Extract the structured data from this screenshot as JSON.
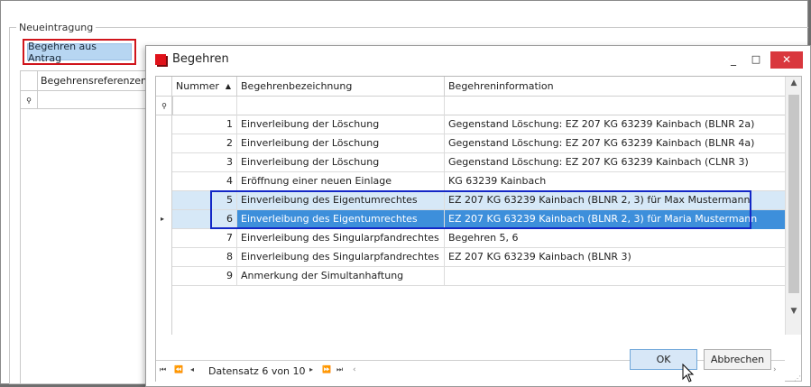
{
  "outer": {
    "group_title": "Neueintragung",
    "antrag_button": "Begehren aus Antrag",
    "left_grid_header": "Begehrensreferenzen",
    "filter_pin_glyph": "ὌC"
  },
  "dialog": {
    "title": "Begehren",
    "title_icon": "app-red-square-icon",
    "minimize_glyph": "_",
    "maximize_glyph": "□",
    "close_glyph": "✕",
    "columns": [
      "Nummer",
      "Begehrenbezeichnung",
      "Begehreninformation"
    ],
    "sort_glyph": "▲",
    "rows": [
      {
        "num": "1",
        "bez": "Einverleibung der Löschung",
        "info": "Gegenstand Löschung: EZ 207 KG 63239 Kainbach (BLNR 2a)"
      },
      {
        "num": "2",
        "bez": "Einverleibung der Löschung",
        "info": "Gegenstand Löschung: EZ 207 KG 63239 Kainbach (BLNR 4a)"
      },
      {
        "num": "3",
        "bez": "Einverleibung der Löschung",
        "info": "Gegenstand Löschung: EZ 207 KG 63239 Kainbach (CLNR 3)"
      },
      {
        "num": "4",
        "bez": "Eröffnung einer neuen Einlage",
        "info": "KG 63239 Kainbach"
      },
      {
        "num": "5",
        "bez": "Einverleibung des Eigentumrechtes",
        "info": "EZ 207 KG 63239 Kainbach (BLNR 2, 3) für Max Mustermann"
      },
      {
        "num": "6",
        "bez": "Einverleibung des Eigentumrechtes",
        "info": "EZ 207 KG 63239 Kainbach (BLNR 2, 3) für Maria Mustermann"
      },
      {
        "num": "7",
        "bez": "Einverleibung des Singularpfandrechtes",
        "info": "Begehren 5, 6"
      },
      {
        "num": "8",
        "bez": "Einverleibung des Singularpfandrechtes",
        "info": "EZ 207 KG 63239 Kainbach (BLNR 3)"
      },
      {
        "num": "9",
        "bez": "Anmerkung der Simultanhaftung",
        "info": ""
      }
    ],
    "current_row_glyph": "▸",
    "navigator": {
      "first": "⏮",
      "prev_page": "⏪",
      "prev": "◂",
      "record": "Datensatz 6 von 10",
      "next": "▸",
      "next_page": "⏩",
      "last": "⏭"
    },
    "ok": "OK",
    "cancel": "Abbrechen"
  },
  "colors": {
    "accent_red": "#d0151c",
    "highlight_blue": "#1327c6",
    "selection": "#3d8fdb"
  }
}
